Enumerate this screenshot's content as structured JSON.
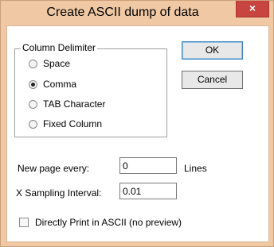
{
  "window": {
    "title": "Create ASCII dump of data",
    "close_symbol": "×"
  },
  "delimiter": {
    "group_label": "Column Delimiter",
    "options": [
      {
        "label": "Space",
        "selected": false
      },
      {
        "label": "Comma",
        "selected": true
      },
      {
        "label": "TAB Character",
        "selected": false
      },
      {
        "label": "Fixed Column",
        "selected": false
      }
    ]
  },
  "buttons": {
    "ok_label": "OK",
    "cancel_label": "Cancel"
  },
  "page": {
    "label": "New page every:",
    "value": "0",
    "unit": "Lines"
  },
  "sampling": {
    "label": "X Sampling Interval:",
    "value": "0.01"
  },
  "print": {
    "label": "Directly Print in ASCII (no preview)",
    "checked": false
  },
  "colors": {
    "title_bar": "#f0c9a4",
    "close_button": "#c74440"
  }
}
